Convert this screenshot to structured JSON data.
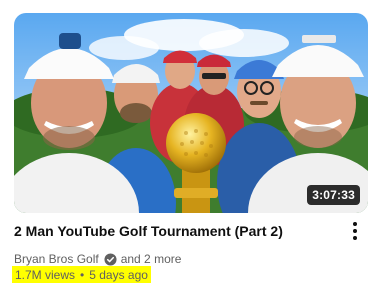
{
  "video": {
    "title": "2 Man YouTube Golf Tournament (Part 2)",
    "duration": "3:07:33",
    "channel": {
      "name": "Bryan Bros Golf",
      "verified_icon": "verified-check-icon",
      "collaborators": "and 2 more"
    },
    "views": "1.7M views",
    "separator": "•",
    "uploaded": "5 days ago"
  },
  "menu_icon": "more-vert-icon",
  "colors": {
    "title_text": "#0f0f0f",
    "meta_text": "#606060",
    "highlight": "#ffff00",
    "badge_bg": "#000000"
  }
}
